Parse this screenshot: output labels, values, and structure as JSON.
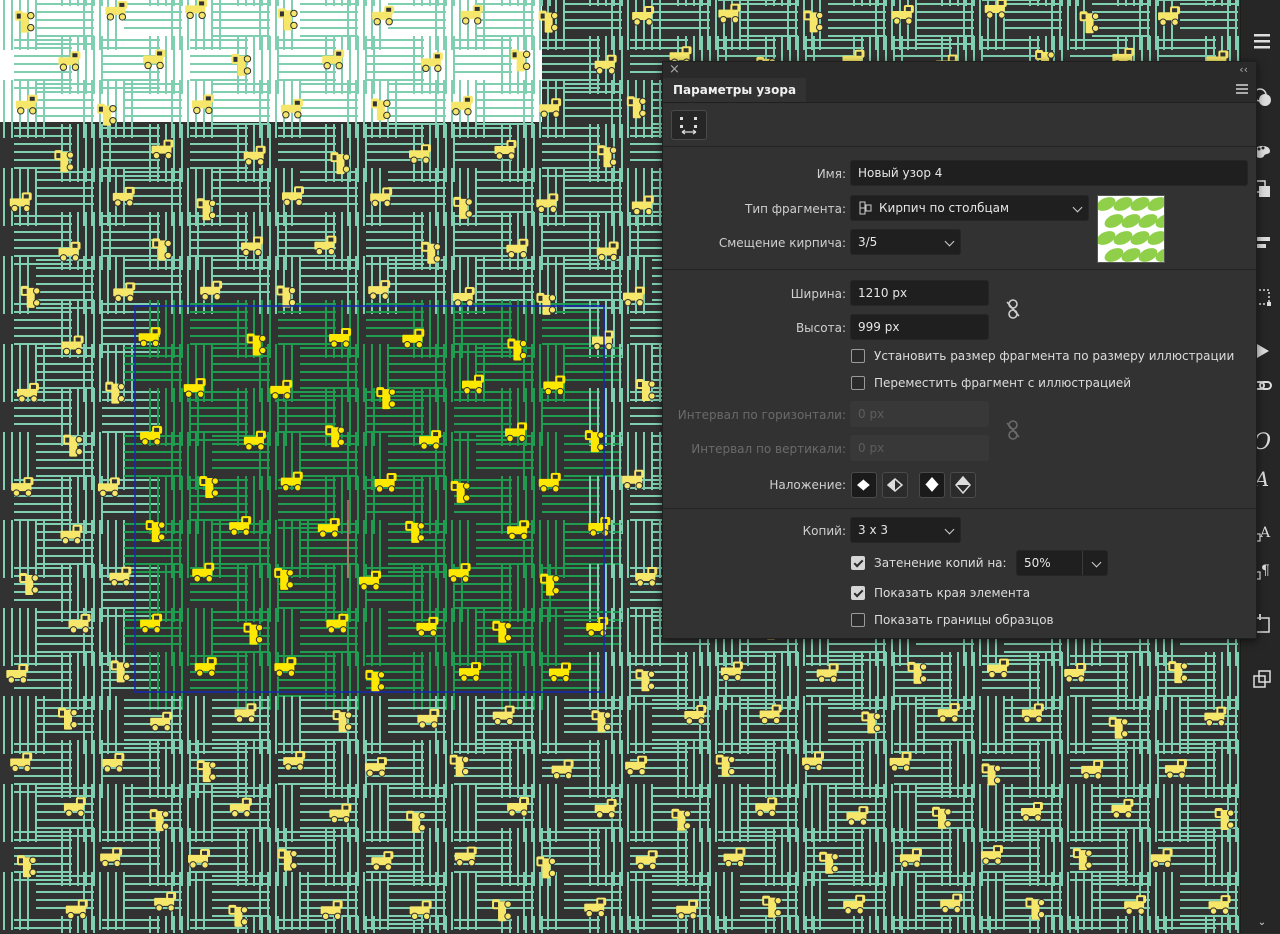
{
  "panel": {
    "title": "Параметры узора",
    "close_glyph": "×",
    "collapse_glyph": "‹‹",
    "name_label": "Имя:",
    "name_value": "Новый узор 4",
    "tile_type_label": "Тип фрагмента:",
    "tile_type_value": "Кирпич по столбцам",
    "brick_offset_label": "Смещение кирпича:",
    "brick_offset_value": "3/5",
    "width_label": "Ширина:",
    "width_value": "1210 px",
    "height_label": "Высота:",
    "height_value": "999 px",
    "size_to_art_label": "Установить размер фрагмента по размеру иллюстрации",
    "size_to_art_checked": false,
    "move_tile_label": "Переместить фрагмент с иллюстрацией",
    "move_tile_checked": false,
    "h_spacing_label": "Интервал по горизонтали:",
    "h_spacing_value": "0 px",
    "v_spacing_label": "Интервал по вертикали:",
    "v_spacing_value": "0 px",
    "overlap_label": "Наложение:",
    "copies_label": "Копий:",
    "copies_value": "3 x 3",
    "dim_copies_label": "Затенение копий на:",
    "dim_copies_checked": true,
    "dim_copies_value": "50%",
    "show_tile_edge_label": "Показать края элемента",
    "show_tile_edge_checked": true,
    "show_swatch_bounds_label": "Показать границы образцов",
    "show_swatch_bounds_checked": false
  },
  "toolbar": {
    "icons": [
      "menu-icon",
      "appearance-icon",
      "swatches-icon",
      "pathfinder-icon",
      "align-icon",
      "transform-icon",
      "actions-icon",
      "links-icon",
      "glyphs-icon",
      "character-icon",
      "character-styles-icon",
      "paragraph-styles-icon",
      "artboards-icon",
      "layers-icon"
    ]
  },
  "colors": {
    "canvas_bg": "#323232",
    "pattern_line": "#7fcfb0",
    "pattern_line_active": "#1f9c50",
    "truck": "#f6e66a",
    "truck_active": "#ffe800",
    "tile_edge": "#1428b4",
    "panel_bg": "#323232"
  }
}
